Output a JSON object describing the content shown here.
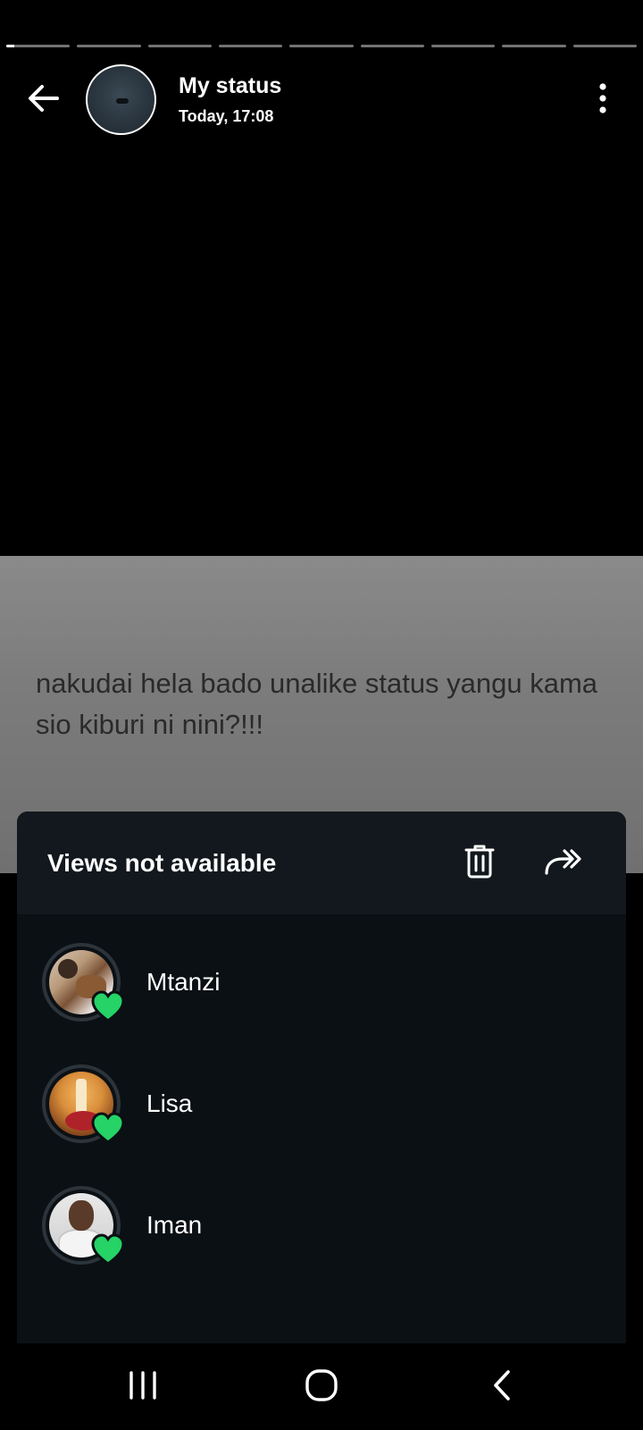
{
  "progress": {
    "segments": 9,
    "active_index": 0,
    "active_fraction": 0.12
  },
  "header": {
    "title": "My status",
    "subtitle": "Today, 17:08",
    "back_icon": "arrow-left-icon",
    "menu_icon": "more-vertical-icon"
  },
  "status": {
    "text": "nakudai hela bado unalike status yangu kama sio kiburi ni nini?!!!"
  },
  "sheet": {
    "title": "Views not available",
    "delete_icon": "trash-icon",
    "forward_icon": "forward-icon",
    "viewers": [
      {
        "name": "Mtanzi",
        "reaction": "heart-icon"
      },
      {
        "name": "Lisa",
        "reaction": "heart-icon"
      },
      {
        "name": "Iman",
        "reaction": "heart-icon"
      }
    ]
  },
  "colors": {
    "heart": "#25d366",
    "sheet_bg": "#0b1014",
    "sheet_header_bg": "#12181d"
  },
  "navbar": {
    "recents_icon": "recent-apps-icon",
    "home_icon": "home-icon",
    "back_icon": "nav-back-icon"
  }
}
